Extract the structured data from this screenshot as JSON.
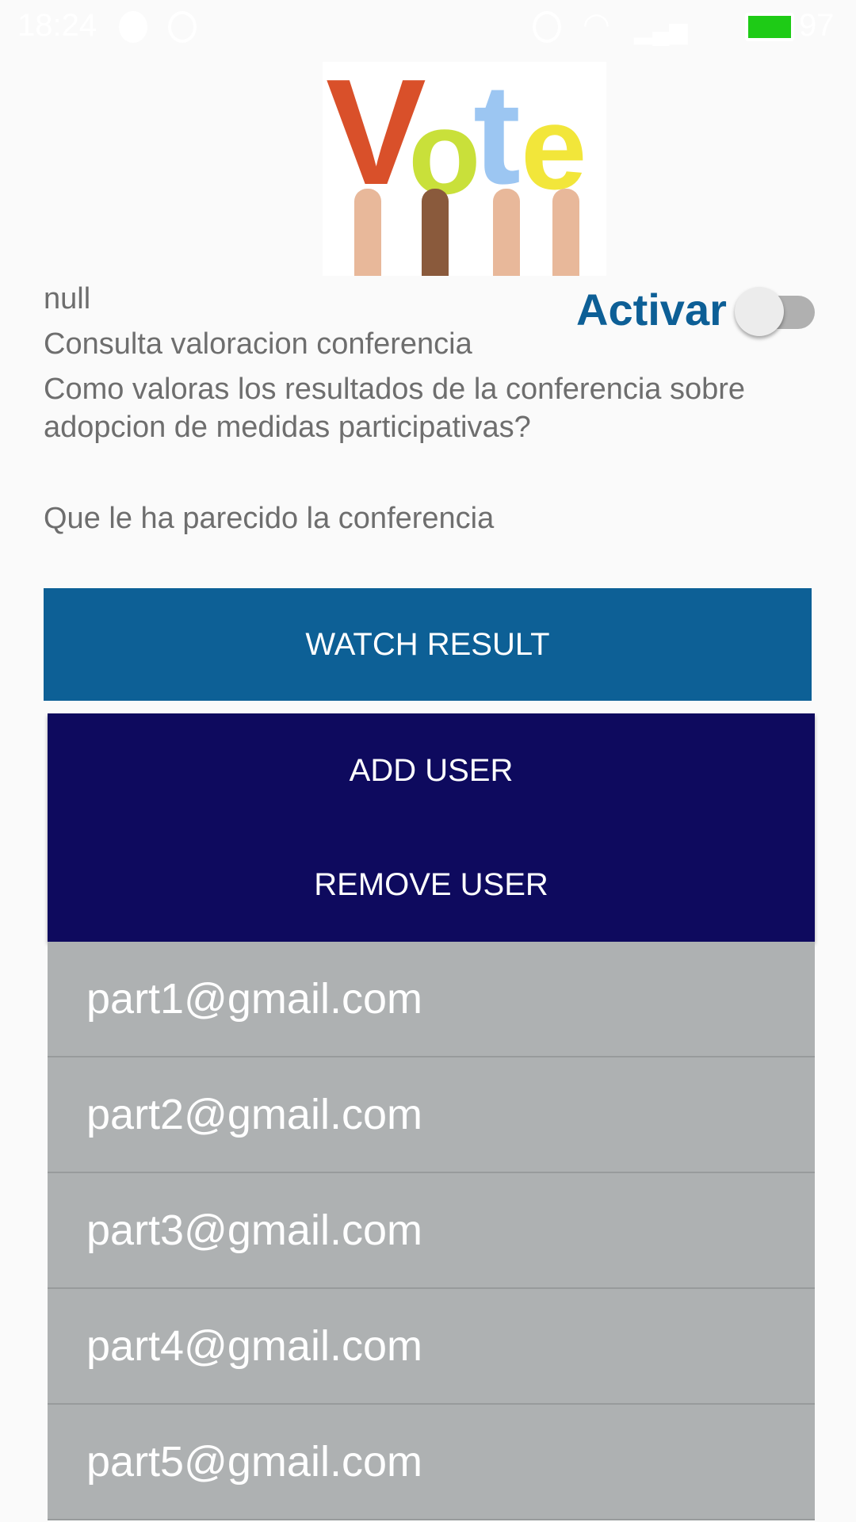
{
  "status_bar": {
    "time": "18:24",
    "battery": "97",
    "battery_color": "#1ecb16",
    "icons": [
      "chat-icon",
      "messenger-icon",
      "share-icon",
      "usb-icon",
      "image-icon",
      "alarm-icon",
      "wifi-icon",
      "signal-icon",
      "lte-icon",
      "charging-icon",
      "battery-icon"
    ]
  },
  "logo": {
    "text": "Vote",
    "letters": [
      "V",
      "o",
      "t",
      "e"
    ],
    "colors": [
      "#d9502a",
      "#c9e03a",
      "#9cc6f2",
      "#f2e63a"
    ]
  },
  "content": {
    "null_text": "null",
    "title": "Consulta valoracion conferencia",
    "question_line1": "Como valoras los resultados de la conferencia sobre",
    "question_line2": "adopcion de medidas participativas?",
    "description": "Que le ha parecido la conferencia"
  },
  "toggle": {
    "label": "Activar",
    "on": false
  },
  "buttons": {
    "watch_result": "WATCH RESULT",
    "add_user": "ADD USER",
    "remove_user": "REMOVE USER"
  },
  "users": [
    "part1@gmail.com",
    "part2@gmail.com",
    "part3@gmail.com",
    "part4@gmail.com",
    "part5@gmail.com"
  ],
  "colors": {
    "primary": "#0d6096",
    "panel": "#0e0a5e",
    "list_bg": "#aeb1b2"
  }
}
